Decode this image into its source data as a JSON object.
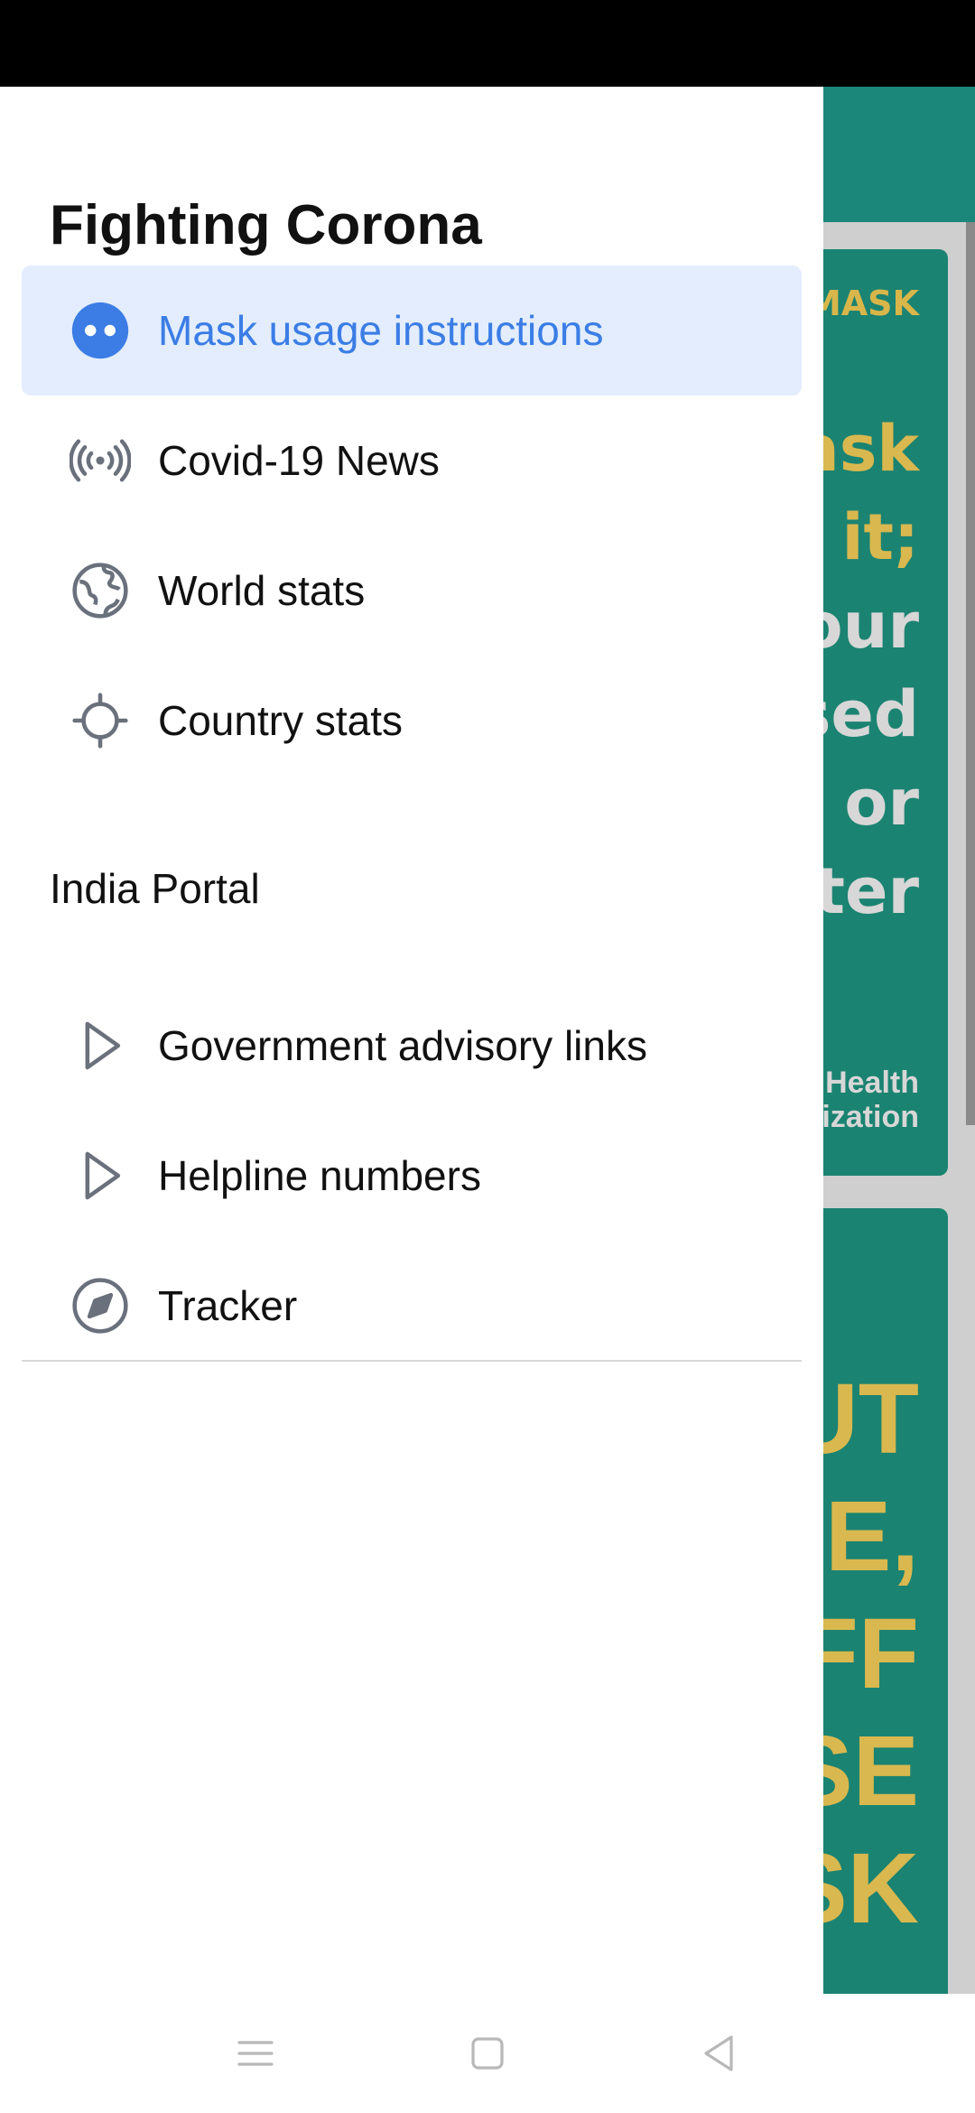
{
  "background_card": {
    "top_label": "MASK",
    "lines": [
      "ask",
      "g it;",
      "our",
      "sed",
      "o or",
      "ter"
    ],
    "caption": [
      "Health",
      "nization"
    ],
    "big_lines": [
      "UT",
      "SE,",
      "FF",
      "SE",
      "SK"
    ]
  },
  "drawer": {
    "title": "Fighting Corona",
    "items": [
      {
        "label": "Mask usage instructions",
        "icon": "mask-icon",
        "active": true
      },
      {
        "label": "Covid-19 News",
        "icon": "broadcast-icon"
      },
      {
        "label": "World stats",
        "icon": "globe-icon"
      },
      {
        "label": "Country stats",
        "icon": "crosshair-icon"
      }
    ],
    "section": "India Portal",
    "section_items": [
      {
        "label": "Government advisory links",
        "icon": "play-icon"
      },
      {
        "label": "Helpline numbers",
        "icon": "play-icon"
      },
      {
        "label": "Tracker",
        "icon": "compass-icon"
      }
    ]
  },
  "colors": {
    "accent": "#3b7de5",
    "active_bg": "#e3edfd",
    "teal": "#1b877a",
    "mask_text": "#d9b84f"
  }
}
